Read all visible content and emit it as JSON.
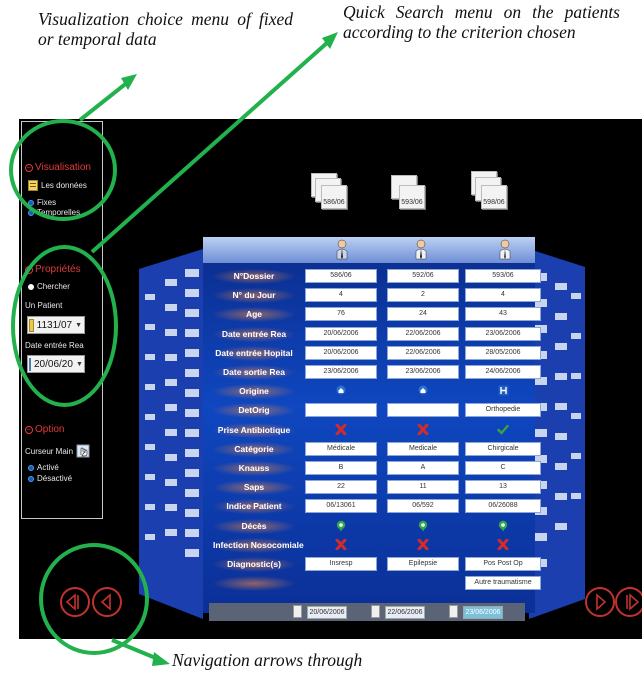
{
  "captions": {
    "visualization": "Visualization choice menu of fixed or temporal data",
    "quick_search": "Quick Search menu on the patients according to the criterion chosen",
    "navigation": "Navigation arrows through"
  },
  "panel": {
    "visualisation": {
      "title": "Visualisation",
      "data_label": "Les données",
      "options": [
        "Fixes",
        "Temporelles"
      ]
    },
    "proprietes": {
      "title": "Propriétés",
      "search_label": "Chercher",
      "patient_label": "Un Patient",
      "patient_value": "1131/07",
      "date_label": "Date entrée Rea",
      "date_value": "20/06/20"
    },
    "option": {
      "title": "Option",
      "cursor_label": "Curseur Main",
      "options": [
        "Activé",
        "Désactivé"
      ]
    }
  },
  "stacks": [
    "586/06",
    "593/06",
    "598/06"
  ],
  "rows": [
    {
      "label": "N°Dossier",
      "values": [
        "586/06",
        "592/06",
        "593/06"
      ]
    },
    {
      "label": "N° du Jour",
      "values": [
        "4",
        "2",
        "4"
      ]
    },
    {
      "label": "Age",
      "values": [
        "76",
        "24",
        "43"
      ]
    },
    {
      "label": "Date entrée Rea",
      "values": [
        "20/06/2006",
        "22/06/2006",
        "23/06/2006"
      ]
    },
    {
      "label": "Date entrée Hopital",
      "values": [
        "20/06/2006",
        "22/06/2006",
        "28/05/2006"
      ]
    },
    {
      "label": "Date sortie Rea",
      "values": [
        "23/06/2006",
        "23/06/2006",
        "24/06/2006"
      ]
    },
    {
      "label": "Origine",
      "values": [
        "",
        "",
        ""
      ],
      "symbols": [
        "home-icon",
        "home-icon",
        "hospital-icon"
      ]
    },
    {
      "label": "DetOrig",
      "values": [
        "",
        "",
        "Orthopedie"
      ]
    },
    {
      "label": "Prise Antibiotique",
      "values": [
        "",
        "",
        ""
      ],
      "symbols": [
        "red-cross-icon",
        "red-cross-icon",
        "green-check-icon"
      ]
    },
    {
      "label": "Catégorie",
      "values": [
        "Médicale",
        "Medicale",
        "Chirgicale"
      ]
    },
    {
      "label": "Knauss",
      "values": [
        "B",
        "A",
        "C"
      ]
    },
    {
      "label": "Saps",
      "values": [
        "22",
        "11",
        "13"
      ]
    },
    {
      "label": "Indice Patient",
      "values": [
        "06/13061",
        "06/592",
        "06/26088"
      ]
    },
    {
      "label": "Décès",
      "values": [
        "",
        "",
        ""
      ],
      "symbols": [
        "green-pin-icon",
        "green-pin-icon",
        "green-pin-icon"
      ]
    },
    {
      "label": "Infection Nosocomiale",
      "values": [
        "",
        "",
        ""
      ],
      "symbols": [
        "red-cross-icon",
        "red-cross-icon",
        "red-cross-icon"
      ]
    },
    {
      "label": "Diagnostic(s)",
      "values": [
        "Insresp",
        "Epilepsie",
        "Pos Post Op"
      ]
    },
    {
      "label": "",
      "values": [
        "",
        "",
        "Autre traumatisme"
      ]
    }
  ],
  "footer_dates": [
    "20/06/2006",
    "22/06/2006",
    "23/06/2006"
  ],
  "colors": {
    "accent_red": "#e03a3a",
    "ring_green": "#22b14c",
    "board_blue": "#0f47c0"
  }
}
